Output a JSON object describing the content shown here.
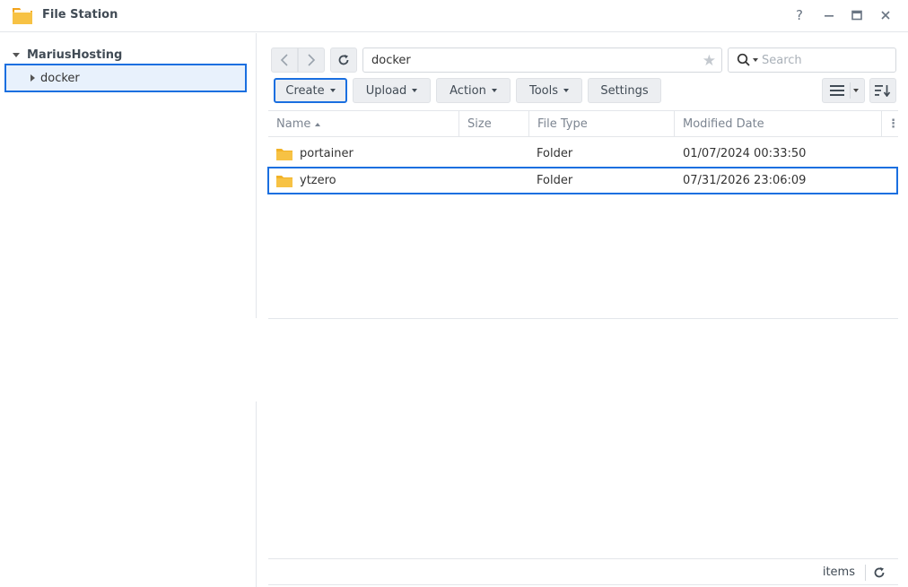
{
  "window": {
    "title": "File Station",
    "controls": {
      "help": "?",
      "minimize": "—",
      "maximize": "☐",
      "close": "✕"
    }
  },
  "sidebar": {
    "root": "MariusHosting",
    "items": [
      {
        "label": "docker",
        "selected": true
      }
    ]
  },
  "navigation": {
    "path": "docker",
    "search_placeholder": "Search"
  },
  "toolbar": {
    "create": "Create",
    "upload": "Upload",
    "action": "Action",
    "tools": "Tools",
    "settings": "Settings"
  },
  "table": {
    "columns": {
      "name": "Name",
      "size": "Size",
      "type": "File Type",
      "modified": "Modified Date",
      "menu": "⋮"
    },
    "rows": [
      {
        "name": "portainer",
        "size": "",
        "type": "Folder",
        "modified": "01/07/2024 00:33:50"
      },
      {
        "name": "ytzero",
        "size": "",
        "type": "Folder",
        "modified": "07/31/2026 23:06:09",
        "highlighted": true
      }
    ]
  },
  "status": {
    "text": "items"
  },
  "colors": {
    "accent": "#1a6fe0",
    "folder": "#f7c244",
    "selected_bg": "#e8f1fc"
  },
  "icons": {
    "app": "file-station-folder-icon",
    "back": "chevron-left-icon",
    "forward": "chevron-right-icon",
    "refresh": "refresh-icon",
    "favorite": "star-icon",
    "search": "search-icon",
    "view": "list-view-icon",
    "sort": "sort-icon"
  }
}
